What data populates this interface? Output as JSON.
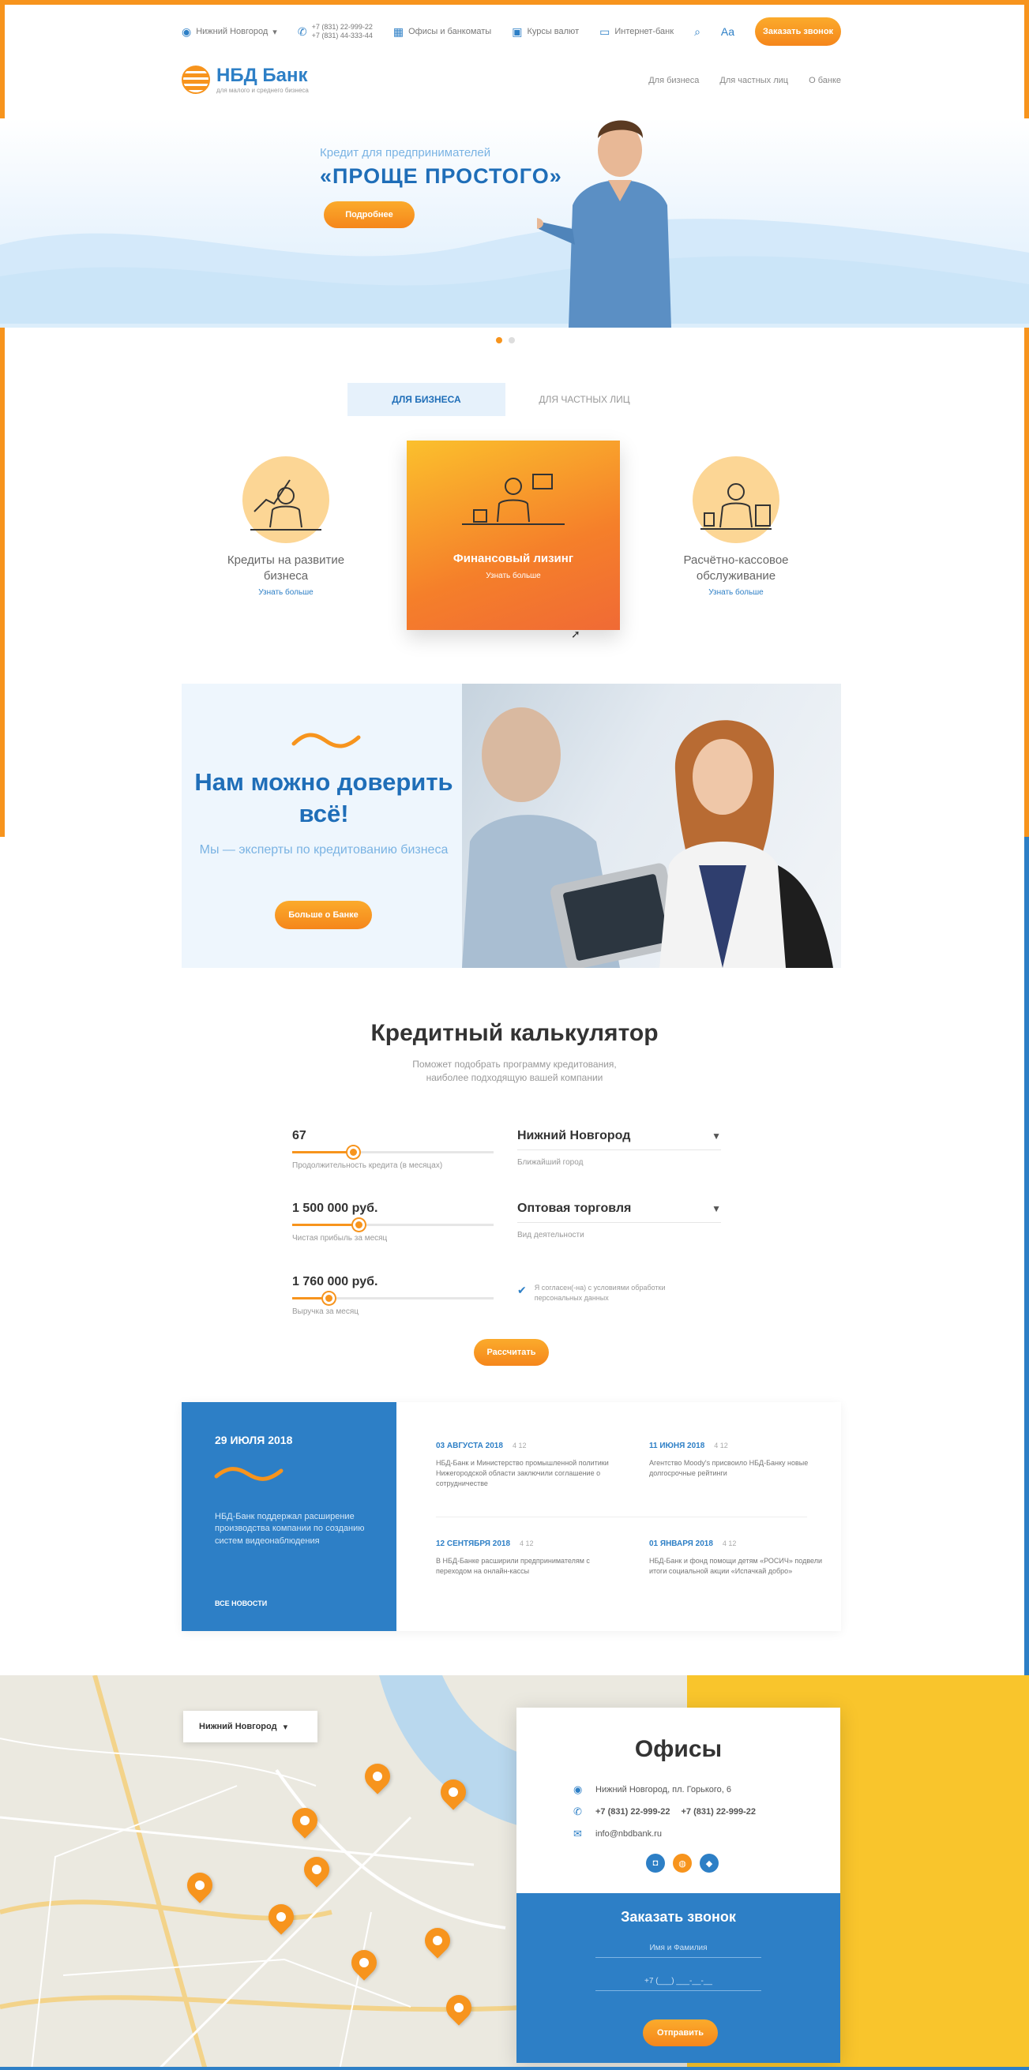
{
  "topbar": {
    "city": "Нижний Новгород",
    "phone1": "+7 (831) 22-999-22",
    "phone2": "+7 (831) 44-333-44",
    "offices": "Офисы и банкоматы",
    "rates": "Курсы валют",
    "online": "Интернет-банк",
    "font_size": "Aa",
    "call_label": "Заказать звонок"
  },
  "logo": {
    "name": "НБД Банк",
    "sub": "для малого и среднего бизнеса"
  },
  "nav": [
    "Для бизнеса",
    "Для частных лиц",
    "О банке"
  ],
  "hero": {
    "subtitle": "Кредит для предпринимателей",
    "title": "«ПРОЩЕ ПРОСТОГО»",
    "button": "Подробнее"
  },
  "tabs": [
    "ДЛЯ БИЗНЕСА",
    "ДЛЯ ЧАСТНЫХ ЛИЦ"
  ],
  "services": [
    {
      "name": "Кредиты на развитие бизнеса",
      "link": "Узнать больше"
    },
    {
      "name": "Финансовый лизинг",
      "link": "Узнать больше"
    },
    {
      "name": "Расчётно-кассовое обслуживание",
      "link": "Узнать больше"
    }
  ],
  "promo": {
    "title": "Нам можно доверить всё!",
    "subtitle": "Мы — эксперты по кредитованию бизнеса",
    "button": "Больше о Банке"
  },
  "calculator": {
    "title": "Кредитный калькулятор",
    "subtitle": "Поможет подобрать программу кредитования, наиболее подходящую вашей компании",
    "fields": [
      {
        "value": "67",
        "label": "Продолжительность кредита (в месяцах)",
        "fill": 0.3
      },
      {
        "value": "1 500 000 руб.",
        "label": "Чистая прибыль за месяц",
        "fill": 0.33
      },
      {
        "value": "1 760 000 руб.",
        "label": "Выручка за месяц",
        "fill": 0.18
      }
    ],
    "selects": [
      {
        "value": "Нижний Новгород",
        "label": "Ближайший город"
      },
      {
        "value": "Оптовая торговля",
        "label": "Вид деятельности"
      }
    ],
    "consent_text": "Я согласен(-на) с условиями обработки персональных данных",
    "button": "Рассчитать"
  },
  "news": {
    "featured": {
      "date": "29 ИЮЛЯ 2018",
      "text": "НБД-Банк поддержал расширение производства компании по созданию систем видеонаблюдения",
      "all": "ВСЕ НОВОСТИ"
    },
    "items": [
      {
        "date": "03 АВГУСТА 2018",
        "views": "4 12",
        "text": "НБД-Банк и Министерство промышленной политики Нижегородской области заключили соглашение о сотрудничестве"
      },
      {
        "date": "11 ИЮНЯ 2018",
        "views": "4 12",
        "text": "Агентство Moody's присвоило НБД-Банку новые долгосрочные рейтинги"
      },
      {
        "date": "12 СЕНТЯБРЯ 2018",
        "views": "4 12",
        "text": "В НБД-Банке расширили предпринимателям с переходом на онлайн-кассы"
      },
      {
        "date": "01 ЯНВАРЯ 2018",
        "views": "4 12",
        "text": "НБД-Банк и фонд помощи детям «РОСИЧ» подвели итоги социальной акции «Испачкай добро»"
      }
    ]
  },
  "offices": {
    "map_city": "Нижний Новгород",
    "title": "Офисы",
    "address": "Нижний Новгород, пл. Горького, 6",
    "phone1": "+7 (831) 22-999-22",
    "phone2": "+7 (831) 22-999-22",
    "email": "info@nbdbank.ru",
    "callback_title": "Заказать звонок",
    "name_placeholder": "Имя и Фамилия",
    "phone_placeholder": "+7 (___) ___-__-__",
    "send": "Отправить"
  },
  "colors": {
    "accent": "#f7941d",
    "brand": "#2d7fc6"
  }
}
